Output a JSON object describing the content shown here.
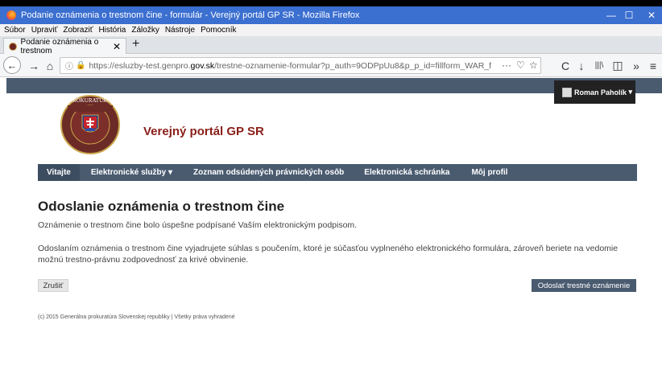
{
  "window": {
    "title": "Podanie oznámenia o trestnom čine - formulár - Verejný portál GP SR - Mozilla Firefox",
    "controls": {
      "minimize": "—",
      "maximize": "☐",
      "close": "✕"
    }
  },
  "menubar": {
    "items": [
      {
        "label": "Súbor"
      },
      {
        "label": "Upraviť"
      },
      {
        "label": "Zobraziť"
      },
      {
        "label": "História"
      },
      {
        "label": "Záložky"
      },
      {
        "label": "Nástroje"
      },
      {
        "label": "Pomocník"
      }
    ]
  },
  "tab": {
    "label": "Podanie oznámenia o trestnom",
    "close": "✕",
    "new_tab": "+"
  },
  "navbar": {
    "back": "←",
    "forward": "→",
    "home": "⌂",
    "url_prefix": "https://esluzby-test.genpro.",
    "url_domain": "gov.sk",
    "url_suffix": "/trestne-oznamenie-formular?p_auth=9ODPpUu8&p_p_id=fillform_WAR_form&p_p_l",
    "more": "···",
    "pocket": "♡",
    "bookmark": "☆",
    "reload": "C",
    "download": "↓",
    "library": "|||\\",
    "sidebar": "◫",
    "overflow": "»",
    "menu": "≡"
  },
  "site": {
    "user_name": "Roman Paholík",
    "portal_title": "Verejný portál GP SR",
    "logo_text": "PROKURATÚRA SLOVENSKEJ REPUBLIKY",
    "nav": [
      {
        "label": "Vitajte",
        "caret": ""
      },
      {
        "label": "Elektronické služby",
        "caret": "▾"
      },
      {
        "label": "Zoznam odsúdených právnických osôb",
        "caret": ""
      },
      {
        "label": "Elektronická schránka",
        "caret": ""
      },
      {
        "label": "Môj profil",
        "caret": ""
      }
    ],
    "heading": "Odoslanie oznámenia o trestnom čine",
    "message": "Oznámenie o trestnom čine bolo úspešne podpísané Vaším elektronickým podpisom.",
    "notice": "Odoslaním oznámenia o trestnom čine vyjadrujete súhlas s poučením, ktoré je súčasťou vyplneného elektronického formulára, zároveň beriete na vedomie možnú trestno-právnu zodpovednosť za krivé obvinenie.",
    "cancel_label": "Zrušiť",
    "submit_label": "Odoslať trestné oznámenie",
    "footer": "(c) 2015 Generálna prokuratúra Slovenskej republiky | Všetky práva vyhradené"
  },
  "colors": {
    "titlebar": "#3b6fd0",
    "site_nav": "#4a5b70",
    "title_red": "#8a1e18"
  }
}
